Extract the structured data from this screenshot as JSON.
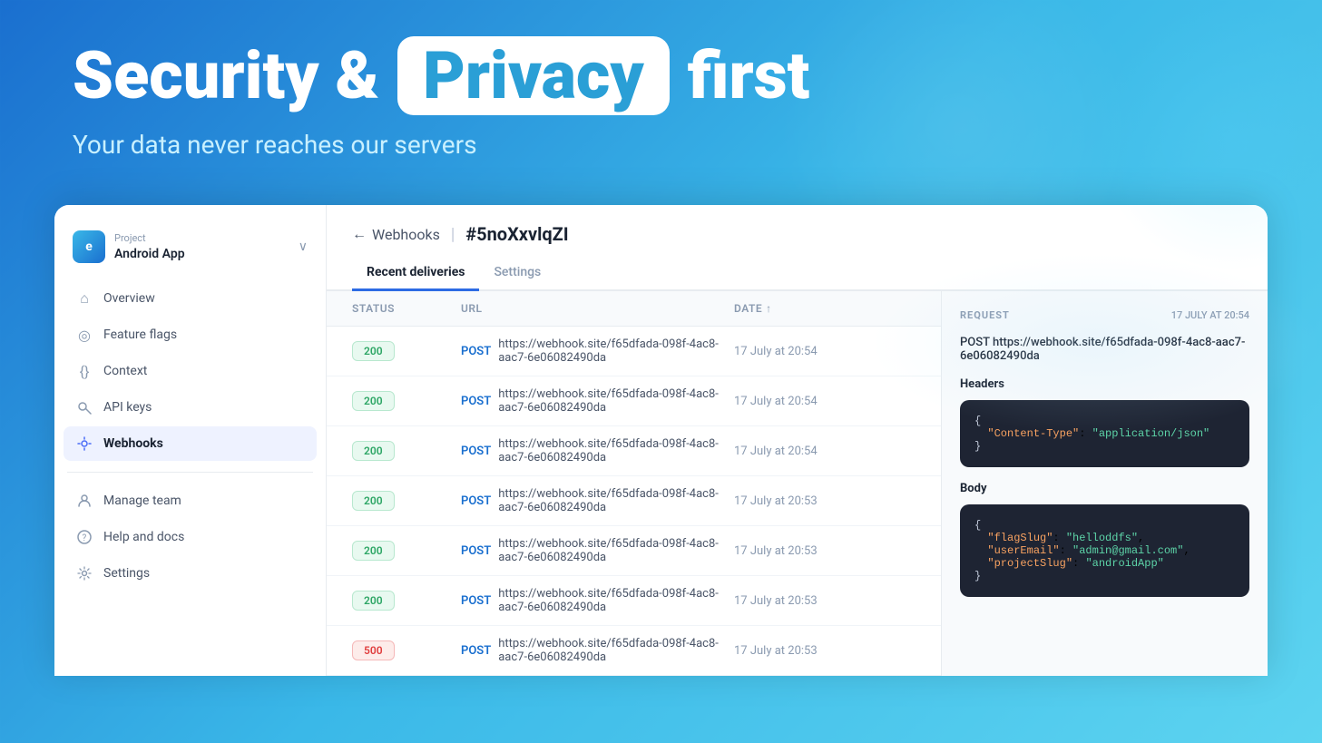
{
  "hero": {
    "title_part1": "Security &",
    "privacy_badge": "Privacy",
    "title_part2": "first",
    "subtitle": "Your data never reaches our servers"
  },
  "sidebar": {
    "project": {
      "label": "Project",
      "name": "Android App"
    },
    "nav_items": [
      {
        "id": "overview",
        "label": "Overview",
        "icon": "⌂"
      },
      {
        "id": "feature-flags",
        "label": "Feature flags",
        "icon": "◎"
      },
      {
        "id": "context",
        "label": "Context",
        "icon": "{}"
      },
      {
        "id": "api-keys",
        "label": "API keys",
        "icon": "🔑"
      },
      {
        "id": "webhooks",
        "label": "Webhooks",
        "icon": "⚡",
        "active": true
      }
    ],
    "bottom_items": [
      {
        "id": "manage-team",
        "label": "Manage team",
        "icon": "👤"
      },
      {
        "id": "help-docs",
        "label": "Help and docs",
        "icon": "❓"
      },
      {
        "id": "settings",
        "label": "Settings",
        "icon": "⚙"
      }
    ]
  },
  "webhooks_page": {
    "back_label": "Webhooks",
    "webhook_id": "#5noXxvlqZI",
    "tabs": [
      {
        "id": "recent-deliveries",
        "label": "Recent deliveries",
        "active": true
      },
      {
        "id": "settings",
        "label": "Settings"
      }
    ],
    "table": {
      "columns": [
        "Status",
        "Url",
        "Date ↑"
      ],
      "rows": [
        {
          "status": "200",
          "method": "POST",
          "url": "https://webhook.site/f65dfada-098f-4ac8-aac7-6e06082490da",
          "date": "17 July at 20:54"
        },
        {
          "status": "200",
          "method": "POST",
          "url": "https://webhook.site/f65dfada-098f-4ac8-aac7-6e06082490da",
          "date": "17 July at 20:54"
        },
        {
          "status": "200",
          "method": "POST",
          "url": "https://webhook.site/f65dfada-098f-4ac8-aac7-6e06082490da",
          "date": "17 July at 20:54"
        },
        {
          "status": "200",
          "method": "POST",
          "url": "https://webhook.site/f65dfada-098f-4ac8-aac7-6e06082490da",
          "date": "17 July at 20:53"
        },
        {
          "status": "200",
          "method": "POST",
          "url": "https://webhook.site/f65dfada-098f-4ac8-aac7-6e06082490da",
          "date": "17 July at 20:53"
        },
        {
          "status": "200",
          "method": "POST",
          "url": "https://webhook.site/f65dfada-098f-4ac8-aac7-6e06082490da",
          "date": "17 July at 20:53"
        },
        {
          "status": "500",
          "method": "POST",
          "url": "https://webhook.site/f65dfada-098f-4ac8-aac7-6e06082490da",
          "date": "17 July at 20:53"
        }
      ]
    }
  },
  "right_panel": {
    "label": "REQUEST",
    "date": "17 JULY AT 20:54",
    "url": "POST https://webhook.site/f65dfada-098f-4ac8-aac7-6e06082490da",
    "headers_label": "Headers",
    "headers_code": "{\n  \"Content-Type\": \"application/json\"\n}",
    "body_label": "Body",
    "body_code": "{\n  \"flagSlug\": \"helloddfs\",\n  \"userEmail\": \"admin@gmail.com\",\n  \"projectSlug\": \"androidApp\"\n}"
  }
}
